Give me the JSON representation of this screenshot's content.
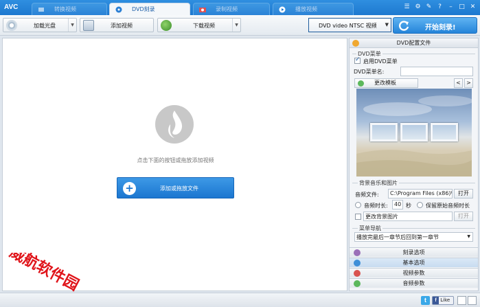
{
  "titlebar": {
    "logo": "AVC",
    "tabs": [
      {
        "label": "转换视频",
        "active": false
      },
      {
        "label": "DVD刻录",
        "active": true
      },
      {
        "label": "录制视频",
        "active": false
      },
      {
        "label": "播放视频",
        "active": false
      }
    ]
  },
  "toolbar": {
    "load_disc": "加载光盘",
    "add_video": "添加视频",
    "download_video": "下载视频",
    "format": "DVD video NTSC 视频",
    "burn": "开始刻录!"
  },
  "main": {
    "hint": "点击下面的按钮或拖放添加视频",
    "add_button": "添加或拖放文件"
  },
  "panel": {
    "title": "DVD配置文件",
    "dvd_menu": {
      "group": "DVD菜单",
      "enable_label": "启用DVD菜单",
      "enabled": true,
      "name_label": "DVD菜单名:",
      "name_value": "",
      "change_template": "更改模板",
      "prev": "<",
      "next": ">"
    },
    "bg": {
      "group": "背景音乐和图片",
      "audio_label": "音频文件:",
      "audio_path": "C:\\Program Files (x86)\\A",
      "open": "打开",
      "duration_label": "音频时长:",
      "duration_value": "40",
      "seconds": "秒",
      "keep_original": "保留原始音频时长",
      "change_bg": "更改背景图片",
      "open2": "打开"
    },
    "nav": {
      "group": "菜单导航",
      "option": "播放完最后一章节后回到第一章节"
    },
    "sections": [
      {
        "label": "刻录选项",
        "active": false,
        "color": "#9b6fb8"
      },
      {
        "label": "基本选项",
        "active": true,
        "color": "#3e8fd8"
      },
      {
        "label": "视频参数",
        "active": false,
        "color": "#d9534f"
      },
      {
        "label": "音频参数",
        "active": false,
        "color": "#5cb85c"
      }
    ]
  },
  "status": {
    "fb_like": "Like"
  },
  "watermark": {
    "text": "威航软件园"
  }
}
